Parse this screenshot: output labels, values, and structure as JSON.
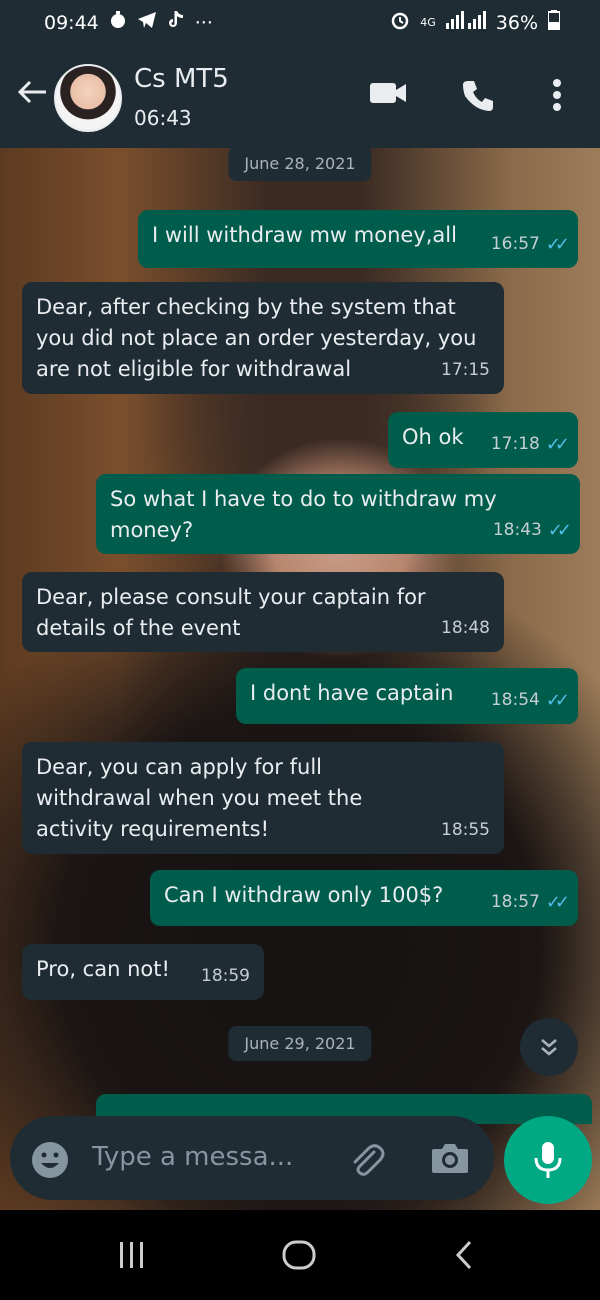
{
  "status_bar": {
    "time": "09:44",
    "left_icons": [
      "timer-icon",
      "telegram-icon",
      "tiktok-icon"
    ],
    "more": "···",
    "network": "4G",
    "battery": "36%"
  },
  "header": {
    "contact_name": "Cs MT5",
    "contact_sub": "06:43"
  },
  "chat": {
    "dates": [
      "June 28, 2021",
      "June 29, 2021"
    ],
    "messages": [
      {
        "dir": "out",
        "text": "I will withdraw mw money,all",
        "time": "16:57"
      },
      {
        "dir": "in",
        "text": "Dear, after checking by the system that you did not place an order yesterday, you are not eligible for withdrawal",
        "time": "17:15"
      },
      {
        "dir": "out",
        "text": "Oh ok",
        "time": "17:18"
      },
      {
        "dir": "out",
        "text": "So what I have to do to withdraw my money?",
        "time": "18:43"
      },
      {
        "dir": "in",
        "text": "Dear, please consult your captain for details of the event",
        "time": "18:48"
      },
      {
        "dir": "out",
        "text": "I dont have captain",
        "time": "18:54"
      },
      {
        "dir": "in",
        "text": "Dear, you can apply for full withdrawal when you meet the activity requirements!",
        "time": "18:55"
      },
      {
        "dir": "out",
        "text": "Can I withdraw  only 100$?",
        "time": "18:57"
      },
      {
        "dir": "in",
        "text": "Pro, can not!",
        "time": "18:59"
      }
    ]
  },
  "composer": {
    "placeholder": "Type a messa..."
  },
  "colors": {
    "outgoing_bubble": "#005c4b",
    "incoming_bubble": "#1f2c34",
    "accent": "#00a884",
    "read_tick": "#53bdeb"
  }
}
